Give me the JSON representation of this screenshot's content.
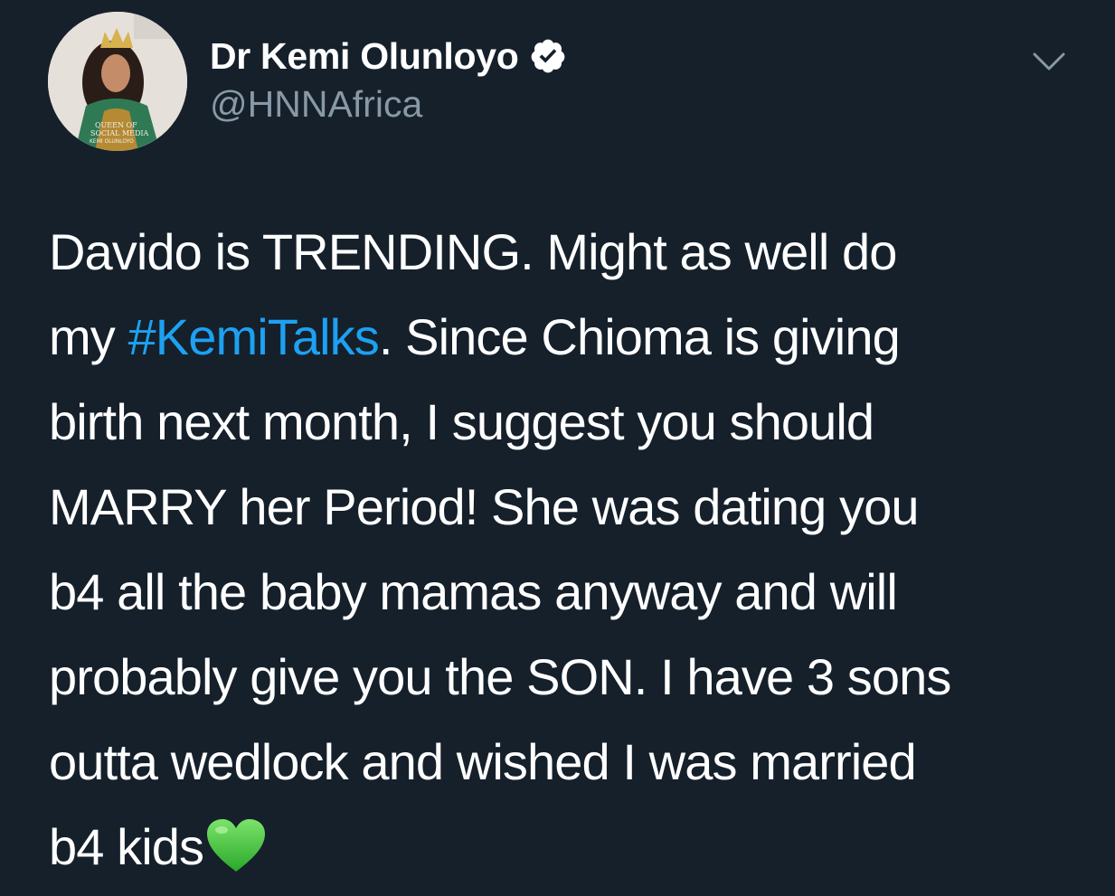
{
  "author": {
    "display_name": "Dr Kemi Olunloyo",
    "handle": "@HNNAfrica",
    "verified": true,
    "avatar_caption": "QUEEN OF SOCIAL MEDIA KEMI OLUNLOYO"
  },
  "tweet": {
    "line1": "Davido is TRENDING. Might as well do",
    "line2_pre": "my ",
    "hashtag": "#KemiTalks",
    "line2_post": ". Since Chioma is giving",
    "line3": "birth next month, I suggest you should",
    "line4": "MARRY her Period! She was dating you",
    "line5": "b4 all the baby mamas anyway and will",
    "line6": "probably give you the SON. I have 3 sons",
    "line7": "outta wedlock and wished I was married",
    "line8": "b4 kids",
    "emoji": "green-heart-icon"
  },
  "colors": {
    "background": "#15202b",
    "text": "#ffffff",
    "secondary": "#8899a6",
    "link": "#1da1f2",
    "heart": "#3fbd3a"
  }
}
